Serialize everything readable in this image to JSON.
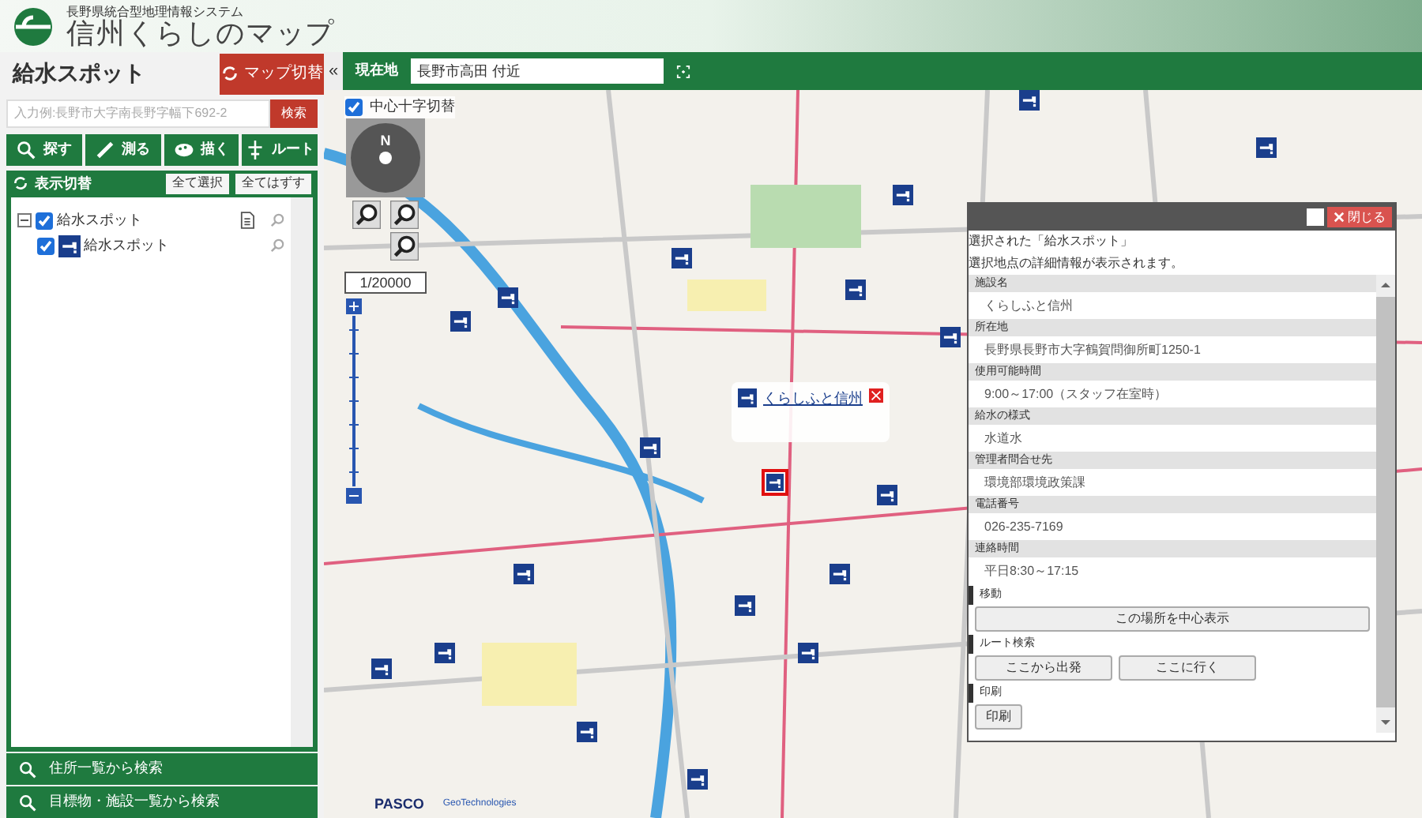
{
  "header": {
    "subtitle": "長野県統合型地理情報システム",
    "title": "信州くらしのマップ"
  },
  "left": {
    "title": "給水スポット",
    "switch_button": "マップ切替",
    "search": {
      "placeholder": "入力例:長野市大字南長野字幅下692-2",
      "button": "検索"
    },
    "tools": [
      {
        "label": "探す",
        "kind": "search"
      },
      {
        "label": "測る",
        "kind": "measure"
      },
      {
        "label": "描く",
        "kind": "draw"
      },
      {
        "label": "ルート",
        "kind": "route"
      }
    ],
    "layer_panel": {
      "title": "表示切替",
      "buttons": [
        "全て選択",
        "全てはずす"
      ],
      "tree": [
        {
          "label": "給水スポット",
          "checked": true,
          "expanded": true,
          "children": [
            {
              "label": "給水スポット",
              "checked": true
            }
          ]
        }
      ]
    },
    "bottom_links": [
      "住所一覧から検索",
      "目標物・施設一覧から検索"
    ]
  },
  "map_bar": {
    "collapse": "«",
    "label": "現在地",
    "value": "長野市高田 付近"
  },
  "map": {
    "center_cross": {
      "label": "中心十字切替",
      "checked": true
    },
    "compass": "N",
    "scale": "1/20000",
    "marker_label": "くらしふと信州",
    "attribution": [
      "PASCO",
      "GeoTechnologies"
    ]
  },
  "popup": {
    "close_label": "閉じる",
    "intro": [
      "選択された「給水スポット」",
      "選択地点の詳細情報が表示されます。"
    ],
    "fields": [
      {
        "label": "施設名",
        "value": "くらしふと信州"
      },
      {
        "label": "所在地",
        "value": "長野県長野市大字鶴賀問御所町1250-1"
      },
      {
        "label": "使用可能時間",
        "value": "9:00～17:00（スタッフ在室時）"
      },
      {
        "label": "給水の様式",
        "value": "水道水"
      },
      {
        "label": "管理者問合せ先",
        "value": "環境部環境政策課"
      },
      {
        "label": "電話番号",
        "value": "026-235-7169"
      },
      {
        "label": "連絡時間",
        "value": "平日8:30～17:15"
      }
    ],
    "sections": [
      {
        "title": "移動",
        "buttons": [
          "この場所を中心表示"
        ]
      },
      {
        "title": "ルート検索",
        "buttons": [
          "ここから出発",
          "ここに行く"
        ]
      },
      {
        "title": "印刷",
        "buttons": [
          "印刷"
        ]
      }
    ]
  }
}
